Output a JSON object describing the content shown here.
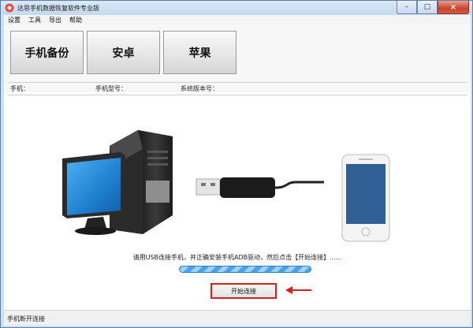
{
  "window": {
    "title": "达思手机数据恢复软件专业版",
    "controls": {
      "minimize": "–",
      "maximize": "□",
      "close": "×"
    }
  },
  "menu": [
    "设置",
    "工具",
    "导出",
    "帮助"
  ],
  "toolbar": {
    "buttons": [
      "手机备份",
      "安卓",
      "苹果"
    ]
  },
  "info": {
    "phone_label": "手机：",
    "model_label": "手机型号：",
    "os_label": "系统版本号："
  },
  "main": {
    "instruction": "请用USB连接手机，并正确安装手机ADB驱动，然后点击【开始连接】......",
    "start_button": "开始连接",
    "progress_state": "indeterminate"
  },
  "status": {
    "text": "手机断开连接"
  },
  "colors": {
    "highlight_box": "#d42020",
    "progress": "#4aa3e8",
    "monitor_screen": "#1f7fd0"
  },
  "icons": [
    "app-icon",
    "computer-icon",
    "usb-cable-icon",
    "smartphone-icon",
    "red-arrow-icon"
  ]
}
